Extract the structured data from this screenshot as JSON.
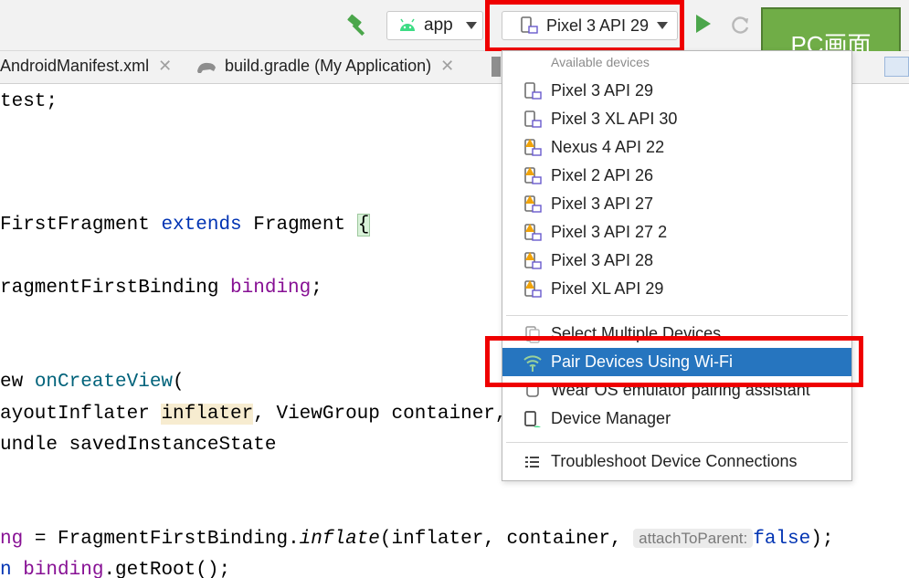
{
  "toolbar": {
    "run_config": "app",
    "device_selector": "Pixel 3 API 29",
    "overlay_label": "PC画面"
  },
  "tabs": [
    {
      "label": "AndroidManifest.xml"
    },
    {
      "label": "build.gradle (My Application)"
    }
  ],
  "code": {
    "l1": "test;",
    "l2a": "FirstFragment ",
    "l2b": "extends",
    "l2c": " Fragment ",
    "l2d": "{",
    "l3a": "ragmentFirstBinding ",
    "l3b": "binding",
    "l3c": ";",
    "l4a": "ew ",
    "l4b": "onCreateView",
    "l4c": "(",
    "l5a": "ayoutInflater ",
    "l5b": "inflater",
    "l5c": ", ViewGroup container,",
    "l6": "undle savedInstanceState",
    "l7a": "ng",
    "l7b": " = FragmentFirstBinding.",
    "l7c": "inflate",
    "l7d": "(inflater, container, ",
    "l7hint": "attachToParent:",
    "l7e": "false",
    "l7f": ");",
    "l8a": "n ",
    "l8b": "binding",
    "l8c": ".getRoot();"
  },
  "dropdown": {
    "header": "Available devices",
    "devices": [
      {
        "label": "Pixel 3 API 29"
      },
      {
        "label": "Pixel 3 XL API 30"
      },
      {
        "label": "Nexus 4 API 22"
      },
      {
        "label": "Pixel 2 API 26"
      },
      {
        "label": "Pixel 3 API 27"
      },
      {
        "label": "Pixel 3 API 27 2"
      },
      {
        "label": "Pixel 3 API 28"
      },
      {
        "label": "Pixel XL API 29"
      }
    ],
    "actions": {
      "select_multiple": "Select Multiple Devices",
      "pair_wifi": "Pair Devices Using Wi-Fi",
      "wear_os": "Wear OS emulator pairing assistant",
      "device_manager": "Device Manager",
      "troubleshoot": "Troubleshoot Device Connections"
    }
  },
  "icons": {
    "build": "hammer-icon",
    "android": "android-icon",
    "device": "phone-icon",
    "device_warning": "phone-warning-icon",
    "run": "run-icon",
    "rerun": "rerun-icon",
    "wifi": "wifi-icon",
    "troubleshoot": "list-icon"
  },
  "colors": {
    "highlight_box": "#ef0000",
    "selection": "#2675bf",
    "overlay_green": "#70ad47",
    "warning": "#f0a30a",
    "device_purple": "#6a5acd"
  }
}
